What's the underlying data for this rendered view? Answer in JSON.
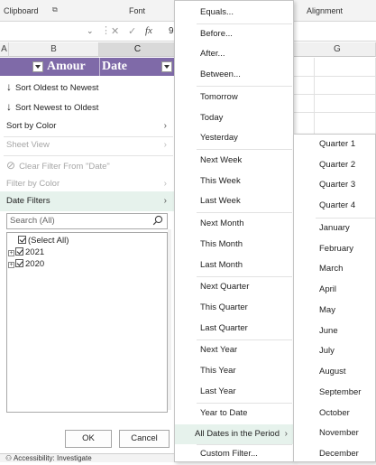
{
  "ribbon": {
    "clipboard": "Clipboard",
    "font": "Font",
    "alignment": "Alignment"
  },
  "formula_bar": {
    "cancel": "✕",
    "enter": "✓",
    "fx": "fx",
    "value": "9"
  },
  "columns": [
    "A",
    "B",
    "C",
    "G"
  ],
  "table_header": {
    "amount": "Amour",
    "date": "Date"
  },
  "filter_menu": {
    "sort_oldest": "Sort Oldest to Newest",
    "sort_newest": "Sort Newest to Oldest",
    "sort_by_color": "Sort by Color",
    "sheet_view": "Sheet View",
    "clear_filter": "Clear Filter From \"Date\"",
    "filter_by_color": "Filter by Color",
    "date_filters": "Date Filters",
    "search_placeholder": "Search (All)",
    "tree": [
      {
        "label": "(Select All)"
      },
      {
        "label": "2021"
      },
      {
        "label": "2020"
      }
    ],
    "ok": "OK",
    "cancel": "Cancel"
  },
  "date_filters_menu": [
    "Equals...",
    "Before...",
    "After...",
    "Between...",
    "Tomorrow",
    "Today",
    "Yesterday",
    "Next Week",
    "This Week",
    "Last Week",
    "Next Month",
    "This Month",
    "Last Month",
    "Next Quarter",
    "This Quarter",
    "Last Quarter",
    "Next Year",
    "This Year",
    "Last Year",
    "Year to Date",
    "All Dates in the Period",
    "Custom Filter..."
  ],
  "period_menu": [
    "Quarter 1",
    "Quarter 2",
    "Quarter 3",
    "Quarter 4",
    "January",
    "February",
    "March",
    "April",
    "May",
    "June",
    "July",
    "August",
    "September",
    "October",
    "November",
    "December"
  ],
  "status_bar": {
    "accessibility": "Accessibility: Investigate"
  },
  "colors": {
    "header_purple": "#7f6aa8",
    "highlight": "#e6f2ec"
  }
}
